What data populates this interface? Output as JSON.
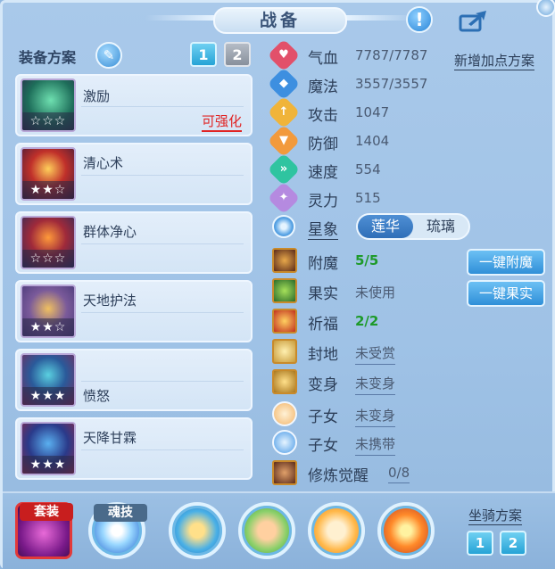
{
  "window": {
    "title": "战备"
  },
  "equip_plan": {
    "label": "装备方案",
    "plans": [
      "1",
      "2"
    ],
    "active_plan": "1"
  },
  "skills": [
    {
      "name": "激励",
      "stars": "☆☆☆",
      "note": "可强化"
    },
    {
      "name": "清心术",
      "stars": "★★☆",
      "note": ""
    },
    {
      "name": "群体净心",
      "stars": "☆☆☆",
      "note": ""
    },
    {
      "name": "天地护法",
      "stars": "★★☆",
      "note": ""
    },
    {
      "name": "愤怒",
      "stars": "★★★",
      "note": ""
    },
    {
      "name": "天降甘霖",
      "stars": "★★★",
      "note": ""
    }
  ],
  "stats": [
    {
      "label": "气血",
      "value": "7787/7787",
      "color": "#e2506a",
      "glyph": "♥"
    },
    {
      "label": "魔法",
      "value": "3557/3557",
      "color": "#3d8fe0",
      "glyph": "◆"
    },
    {
      "label": "攻击",
      "value": "1047",
      "color": "#f0b43a",
      "glyph": "↑"
    },
    {
      "label": "防御",
      "value": "1404",
      "color": "#f29a3c",
      "glyph": "▼"
    },
    {
      "label": "速度",
      "value": "554",
      "color": "#2fc4a0",
      "glyph": "»"
    },
    {
      "label": "灵力",
      "value": "515",
      "color": "#b58ae0",
      "glyph": "✦"
    }
  ],
  "new_plan_link": "新增加点方案",
  "xingxiang": {
    "label": "星象",
    "options": [
      "莲华",
      "琉璃"
    ],
    "selected": "莲华"
  },
  "enhancements": [
    {
      "label": "附魔",
      "value": "5/5",
      "style": "green",
      "color": "#7a4a2a"
    },
    {
      "label": "果实",
      "value": "未使用",
      "style": "plain",
      "color": "#4a8a2a"
    },
    {
      "label": "祈福",
      "value": "2/2",
      "style": "green",
      "color": "#c8561e"
    },
    {
      "label": "封地",
      "value": "未受赏",
      "style": "under",
      "color": "#c89a3a"
    },
    {
      "label": "变身",
      "value": "未变身",
      "style": "under",
      "color": "#b8862a"
    },
    {
      "label": "子女",
      "value": "未变身",
      "style": "under",
      "color": "#f2b46a"
    },
    {
      "label": "子女",
      "value": "未携带",
      "style": "under",
      "color": "#4a9ae6"
    },
    {
      "label": "修炼觉醒",
      "value": "0/8",
      "style": "under",
      "color": "#8a5a3a"
    }
  ],
  "actions": {
    "enchant": "一键附魔",
    "fruit": "一键果实"
  },
  "bottom": {
    "suit_label": "套装",
    "soul_label": "魂技",
    "mount_label": "坐骑方案",
    "mount_plans": [
      "1",
      "2"
    ]
  }
}
